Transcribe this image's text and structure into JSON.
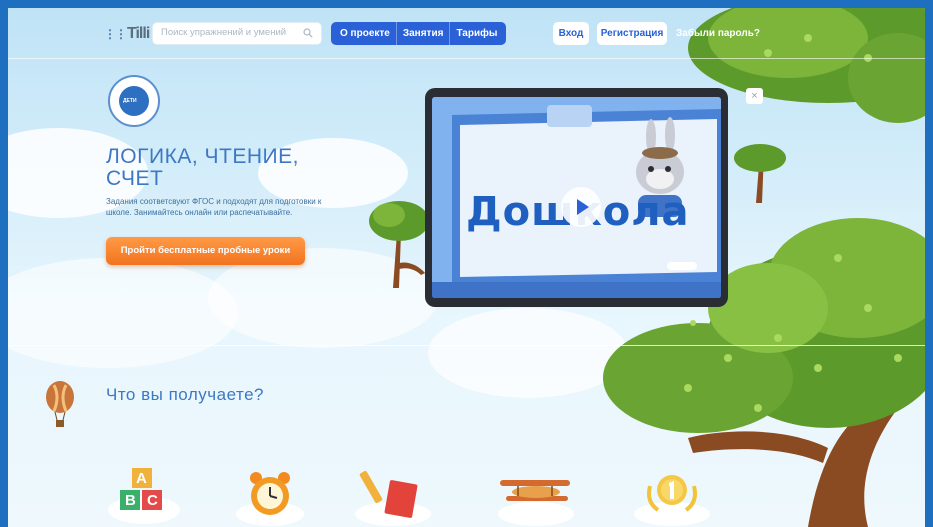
{
  "header": {
    "logo_text": "Tilli",
    "search_placeholder": "Поиск упражнений и умений",
    "nav": [
      {
        "label": "О проекте"
      },
      {
        "label": "Занятия"
      },
      {
        "label": "Тарифы"
      }
    ],
    "login_label": "Вход",
    "register_label": "Регистрация",
    "forgot_label": "Забыли пароль?"
  },
  "badge": {
    "text": "ДЕТИ"
  },
  "hero": {
    "title": "ЛОГИКА, ЧТЕНИЕ, СЧЕТ",
    "description": "Задания соответсвуют ФГОС и подходят для подготовки к школе. Занимайтесь онлайн или распечатывайте.",
    "cta_label": "Пройти бесплатные пробные уроки"
  },
  "video": {
    "screen_text": "Дошкола",
    "close_glyph": "×"
  },
  "benefits": {
    "title": "Что вы получаете?",
    "abc": [
      "A",
      "B",
      "C"
    ]
  },
  "colors": {
    "accent_blue": "#2b61d6",
    "cta_orange": "#f2741f",
    "title_blue": "#3c78c4",
    "frame_blue": "#1f6fc0"
  },
  "icons": {
    "search": "search-icon",
    "close": "close-icon",
    "play": "play-icon",
    "balloon": "hot-air-balloon-icon"
  }
}
